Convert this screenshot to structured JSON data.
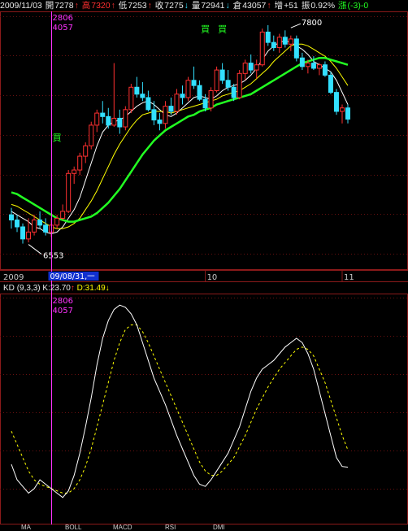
{
  "header": {
    "date": "2009/11/03",
    "open_label": "開",
    "open": "7278",
    "open_arrow": "↑",
    "high_label": "高",
    "high": "7320",
    "high_arrow": "↑",
    "low_label": "低",
    "low": "7253",
    "low_arrow": "↑",
    "close_label": "收",
    "close": "7275",
    "close_arrow": "↓",
    "volume_label": "量",
    "volume": "72941",
    "volume_arrow": "↓",
    "oi_label": "倉",
    "oi": "43057",
    "oi_arrow": "↑",
    "change_label": "增",
    "change": "+51",
    "amplitude_label": "振",
    "amplitude": "0.92%",
    "rise_label": "漲",
    "rise": "(-3)-0"
  },
  "colors": {
    "background": "#000000",
    "grid": "#6a1010",
    "axis": "#8b1a1a",
    "up": "#ff3030",
    "down": "#33e0ff",
    "ma_short": "#ffffff",
    "ma_mid": "#ffff00",
    "ma_long": "#22ff22",
    "cursor": "#ff33ff",
    "signal": "#22ff22",
    "k_line": "#ffffff",
    "d_line": "#ffff00"
  },
  "cursor": {
    "top_value": "2806",
    "bottom_value": "4057",
    "kd_top_value": "2806",
    "kd_bottom_value": "4057",
    "date_label": "09/08/31,一"
  },
  "x_axis": {
    "year_label": "2009",
    "month_labels": [
      {
        "label": "10",
        "at": 34
      },
      {
        "label": "11",
        "at": 58
      }
    ]
  },
  "chart_data": [
    {
      "type": "candlestick",
      "title": "",
      "ylim": [
        6400,
        7900
      ],
      "annotations": [
        {
          "label": "6553",
          "at": 3,
          "value": 6553
        },
        {
          "label": "7800",
          "at": 49,
          "value": 7800
        }
      ],
      "signals": [
        {
          "label": "買",
          "at": 8,
          "value": 7150
        },
        {
          "label": "買",
          "at": 34,
          "value": 7780
        },
        {
          "label": "買",
          "at": 37,
          "value": 7780
        }
      ],
      "ohlc": [
        [
          6720,
          6760,
          6640,
          6690
        ],
        [
          6690,
          6720,
          6620,
          6650
        ],
        [
          6650,
          6670,
          6553,
          6580
        ],
        [
          6580,
          6700,
          6560,
          6620
        ],
        [
          6620,
          6720,
          6600,
          6690
        ],
        [
          6690,
          6740,
          6640,
          6660
        ],
        [
          6660,
          6700,
          6600,
          6620
        ],
        [
          6620,
          6700,
          6590,
          6660
        ],
        [
          6660,
          6720,
          6640,
          6700
        ],
        [
          6700,
          6780,
          6690,
          6740
        ],
        [
          6740,
          6980,
          6730,
          6960
        ],
        [
          6960,
          7000,
          6900,
          6980
        ],
        [
          6980,
          7080,
          6950,
          7060
        ],
        [
          7060,
          7140,
          7020,
          7120
        ],
        [
          7120,
          7260,
          7100,
          7240
        ],
        [
          7240,
          7330,
          7200,
          7310
        ],
        [
          7310,
          7380,
          7250,
          7290
        ],
        [
          7290,
          7340,
          7220,
          7240
        ],
        [
          7240,
          7600,
          7230,
          7280
        ],
        [
          7280,
          7330,
          7190,
          7230
        ],
        [
          7230,
          7350,
          7210,
          7330
        ],
        [
          7330,
          7480,
          7310,
          7460
        ],
        [
          7460,
          7520,
          7400,
          7420
        ],
        [
          7420,
          7490,
          7380,
          7400
        ],
        [
          7400,
          7440,
          7320,
          7330
        ],
        [
          7330,
          7380,
          7240,
          7270
        ],
        [
          7270,
          7310,
          7210,
          7250
        ],
        [
          7250,
          7380,
          7220,
          7350
        ],
        [
          7350,
          7400,
          7300,
          7320
        ],
        [
          7320,
          7450,
          7300,
          7420
        ],
        [
          7420,
          7470,
          7360,
          7400
        ],
        [
          7400,
          7520,
          7380,
          7500
        ],
        [
          7500,
          7580,
          7450,
          7470
        ],
        [
          7470,
          7500,
          7380,
          7390
        ],
        [
          7390,
          7420,
          7320,
          7340
        ],
        [
          7340,
          7460,
          7320,
          7440
        ],
        [
          7440,
          7580,
          7430,
          7560
        ],
        [
          7560,
          7600,
          7480,
          7500
        ],
        [
          7500,
          7560,
          7440,
          7460
        ],
        [
          7460,
          7480,
          7380,
          7400
        ],
        [
          7400,
          7560,
          7390,
          7540
        ],
        [
          7540,
          7620,
          7500,
          7600
        ],
        [
          7600,
          7650,
          7540,
          7560
        ],
        [
          7560,
          7620,
          7510,
          7590
        ],
        [
          7590,
          7800,
          7580,
          7780
        ],
        [
          7780,
          7820,
          7700,
          7720
        ],
        [
          7720,
          7760,
          7670,
          7690
        ],
        [
          7690,
          7770,
          7660,
          7750
        ],
        [
          7750,
          7790,
          7690,
          7710
        ],
        [
          7710,
          7760,
          7670,
          7740
        ],
        [
          7740,
          7760,
          7610,
          7630
        ],
        [
          7630,
          7660,
          7560,
          7580
        ],
        [
          7580,
          7620,
          7540,
          7600
        ],
        [
          7600,
          7640,
          7560,
          7570
        ],
        [
          7570,
          7600,
          7530,
          7590
        ],
        [
          7590,
          7610,
          7520,
          7530
        ],
        [
          7530,
          7550,
          7420,
          7430
        ],
        [
          7430,
          7450,
          7300,
          7320
        ],
        [
          7320,
          7360,
          7250,
          7340
        ],
        [
          7340,
          7360,
          7250,
          7275
        ]
      ],
      "ma": [
        {
          "name": "MA5",
          "color": "#ffffff",
          "values": [
            6740,
            6720,
            6700,
            6680,
            6650,
            6640,
            6620,
            6610,
            6620,
            6650,
            6700,
            6750,
            6820,
            6920,
            7020,
            7120,
            7200,
            7240,
            7260,
            7270,
            7290,
            7320,
            7350,
            7370,
            7380,
            7360,
            7330,
            7300,
            7290,
            7310,
            7340,
            7370,
            7400,
            7410,
            7400,
            7390,
            7410,
            7440,
            7460,
            7470,
            7480,
            7500,
            7530,
            7570,
            7620,
            7670,
            7700,
            7720,
            7730,
            7720,
            7700,
            7680,
            7650,
            7610,
            7590,
            7570,
            7550,
            7500,
            7430,
            7360
          ]
        },
        {
          "name": "MA10",
          "color": "#ffff00",
          "values": [
            6780,
            6770,
            6750,
            6730,
            6710,
            6690,
            6670,
            6650,
            6640,
            6640,
            6650,
            6670,
            6700,
            6750,
            6800,
            6860,
            6930,
            7000,
            7070,
            7130,
            7180,
            7230,
            7270,
            7300,
            7310,
            7320,
            7320,
            7320,
            7310,
            7320,
            7330,
            7340,
            7350,
            7360,
            7370,
            7380,
            7390,
            7410,
            7420,
            7430,
            7440,
            7460,
            7480,
            7510,
            7540,
            7570,
            7610,
            7640,
            7670,
            7700,
            7710,
            7710,
            7700,
            7680,
            7660,
            7640,
            7610,
            7570,
            7520,
            7470
          ]
        },
        {
          "name": "MA20",
          "color": "#22ff22",
          "values": [
            6850,
            6840,
            6820,
            6800,
            6780,
            6760,
            6740,
            6720,
            6700,
            6690,
            6680,
            6680,
            6690,
            6700,
            6710,
            6730,
            6760,
            6790,
            6830,
            6870,
            6920,
            6970,
            7020,
            7070,
            7110,
            7150,
            7180,
            7210,
            7230,
            7250,
            7270,
            7290,
            7300,
            7320,
            7330,
            7340,
            7360,
            7370,
            7380,
            7390,
            7400,
            7410,
            7420,
            7440,
            7460,
            7480,
            7500,
            7520,
            7540,
            7560,
            7580,
            7600,
            7610,
            7620,
            7630,
            7630,
            7620,
            7610,
            7600,
            7590
          ]
        }
      ]
    },
    {
      "type": "line",
      "title": "KD",
      "params": "(9,3,3)",
      "series": [
        {
          "name": "K",
          "color": "#ffffff",
          "last": "23.70",
          "values": [
            25,
            18,
            15,
            12,
            14,
            18,
            16,
            14,
            12,
            10,
            13,
            20,
            30,
            42,
            55,
            70,
            82,
            90,
            95,
            97,
            96,
            93,
            88,
            80,
            72,
            64,
            58,
            52,
            45,
            38,
            32,
            26,
            20,
            16,
            15,
            18,
            22,
            26,
            30,
            36,
            42,
            50,
            58,
            64,
            68,
            70,
            72,
            75,
            78,
            80,
            82,
            80,
            75,
            68,
            58,
            48,
            38,
            28,
            24,
            23.7
          ]
        },
        {
          "name": "D",
          "color": "#ffff00",
          "last": "31.49",
          "values": [
            40,
            34,
            28,
            22,
            18,
            16,
            15,
            14,
            13,
            12,
            12,
            14,
            18,
            24,
            32,
            42,
            52,
            62,
            72,
            80,
            86,
            88,
            88,
            85,
            80,
            74,
            68,
            62,
            56,
            50,
            44,
            38,
            32,
            26,
            22,
            20,
            20,
            22,
            25,
            28,
            33,
            38,
            44,
            50,
            55,
            60,
            64,
            68,
            71,
            74,
            77,
            78,
            77,
            74,
            68,
            62,
            54,
            46,
            38,
            31.49
          ]
        }
      ],
      "ylim": [
        0,
        100
      ]
    }
  ],
  "kd_header": {
    "name": "KD",
    "params": "(9,3,3)",
    "k_label": "K:",
    "k_value": "23.70",
    "k_arrow": "↑",
    "d_label": "D:",
    "d_value": "31.49",
    "d_arrow": "↓"
  },
  "bottom_tabs": [
    "MA",
    "BOLL",
    "MACD",
    "RSI",
    "DMI"
  ]
}
